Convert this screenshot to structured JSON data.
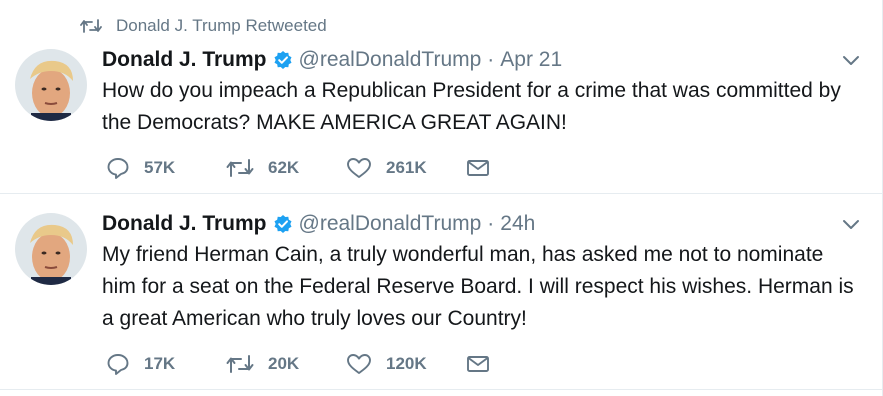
{
  "retweet_context": {
    "label": "Donald J. Trump Retweeted"
  },
  "tweets": [
    {
      "name": "Donald J. Trump",
      "handle": "@realDonaldTrump",
      "separator": "·",
      "time": "Apr 21",
      "text": "How do you impeach a Republican President for a crime that was committed by the Democrats? MAKE AMERICA GREAT AGAIN!",
      "replies": "57K",
      "retweets": "62K",
      "likes": "261K"
    },
    {
      "name": "Donald J. Trump",
      "handle": "@realDonaldTrump",
      "separator": "·",
      "time": "24h",
      "text": "My friend Herman Cain, a truly wonderful man, has asked me not to nominate him for a seat on the Federal Reserve Board. I will respect his wishes. Herman is a great American who truly loves our Country!",
      "replies": "17K",
      "retweets": "20K",
      "likes": "120K"
    }
  ],
  "colors": {
    "muted": "#657786",
    "text": "#14171a",
    "verified": "#1da1f2",
    "divider": "#e6ecf0"
  },
  "icons": [
    "retweet-icon",
    "verified-badge-icon",
    "caret-down-icon",
    "reply-icon",
    "like-icon",
    "message-icon"
  ]
}
